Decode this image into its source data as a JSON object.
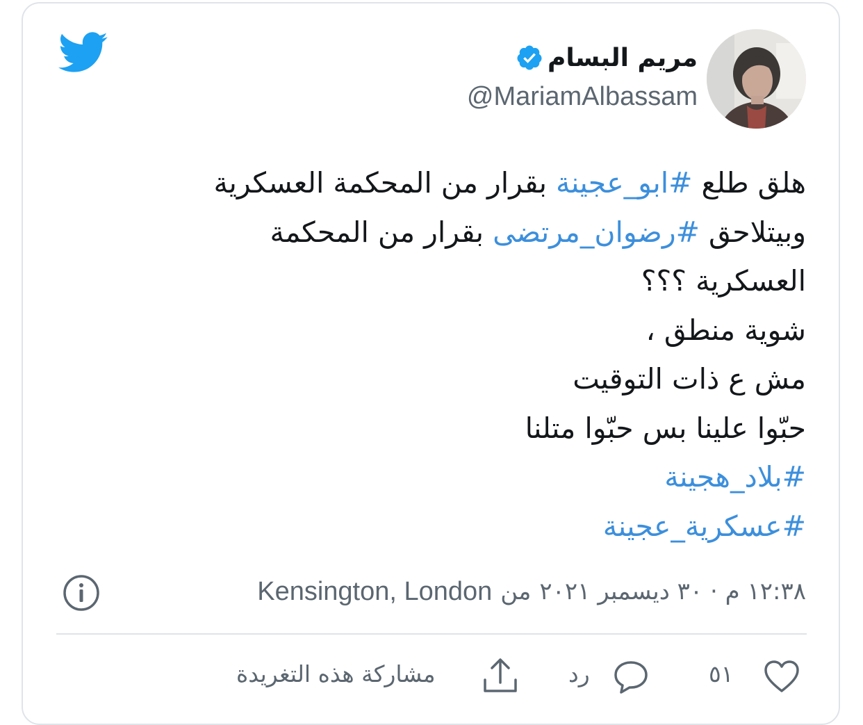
{
  "author": {
    "name": "مريم البسام",
    "handle": "@MariamAlbassam",
    "verified": true
  },
  "icons": {
    "brand": "twitter-bird-icon",
    "verified": "verified-badge-icon",
    "info": "info-icon",
    "like": "heart-icon",
    "reply": "speech-bubble-icon",
    "share": "share-upload-icon"
  },
  "colors": {
    "accent": "#1da1f2",
    "hashtag": "#3c8fdc",
    "muted": "#5b6670",
    "text": "#14171a",
    "border": "#dfe4e8"
  },
  "tweet": {
    "lines": [
      [
        {
          "text": "هلق طلع ",
          "type": "text"
        },
        {
          "text": "#ابو_عجينة",
          "type": "hashtag"
        },
        {
          "text": " بقرار من المحكمة العسكرية",
          "type": "text"
        }
      ],
      [
        {
          "text": "وبيتلاحق  ",
          "type": "text"
        },
        {
          "text": "#رضوان_مرتضى",
          "type": "hashtag"
        },
        {
          "text": " بقرار من المحكمة",
          "type": "text"
        }
      ],
      [
        {
          "text": "العسكرية ؟؟؟",
          "type": "text"
        }
      ],
      [
        {
          "text": "شوية منطق ،",
          "type": "text"
        }
      ],
      [
        {
          "text": "مش ع ذات التوقيت",
          "type": "text"
        }
      ],
      [
        {
          "text": "حبّوا علينا بس حبّوا متلنا",
          "type": "text"
        }
      ],
      [
        {
          "text": "#بلاد_هجينة",
          "type": "hashtag"
        }
      ],
      [
        {
          "text": "#عسكرية_عجينة",
          "type": "hashtag"
        }
      ]
    ]
  },
  "meta": {
    "time_date": "١٢:٣٨ م · ٣٠ ديسمبر ٢٠٢١",
    "from_label": "من",
    "location": "Kensington, London"
  },
  "actions": {
    "like_count": "٥١",
    "reply_label": "رد",
    "share_label": "مشاركة هذه التغريدة"
  }
}
